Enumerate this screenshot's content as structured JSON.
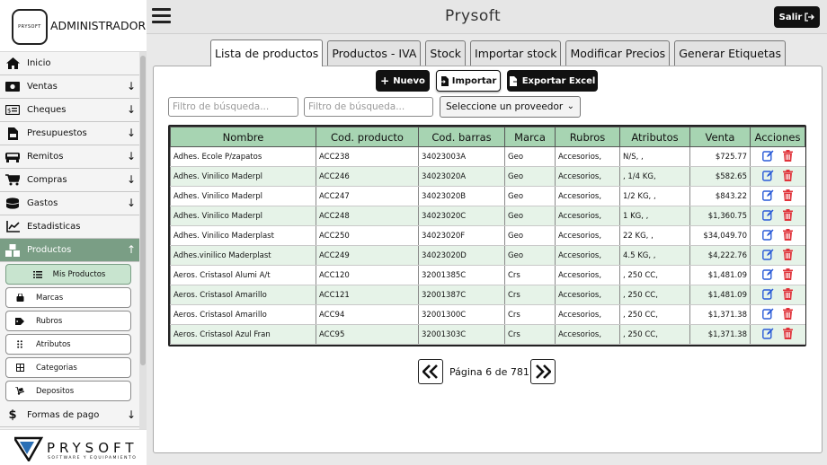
{
  "brand": {
    "title": "ADMINISTRADOR",
    "logo_text": "PRYSOFT"
  },
  "topbar": {
    "title": "Prysoft",
    "logout_label": "Salir"
  },
  "sidebar": {
    "items": [
      {
        "label": "Inicio",
        "icon": "home-icon",
        "arrow": ""
      },
      {
        "label": "Ventas",
        "icon": "money-icon",
        "arrow": "↓"
      },
      {
        "label": "Cheques",
        "icon": "cheque-icon",
        "arrow": "↓"
      },
      {
        "label": "Presupuestos",
        "icon": "file-invoice-icon",
        "arrow": "↓"
      },
      {
        "label": "Remitos",
        "icon": "truck-icon",
        "arrow": "↓"
      },
      {
        "label": "Compras",
        "icon": "cart-icon",
        "arrow": "↓"
      },
      {
        "label": "Gastos",
        "icon": "coins-icon",
        "arrow": "↓"
      },
      {
        "label": "Estadisticas",
        "icon": "chart-line-icon",
        "arrow": ""
      },
      {
        "label": "Productos",
        "icon": "boxes-icon",
        "arrow": "↑"
      }
    ],
    "subitems": [
      {
        "label": "Mis Productos",
        "icon": "list-icon"
      },
      {
        "label": "Marcas",
        "icon": "bag-icon"
      },
      {
        "label": "Rubros",
        "icon": "tags-icon"
      },
      {
        "label": "Atributos",
        "icon": "grip-icon"
      },
      {
        "label": "Categorias",
        "icon": "table-icon"
      },
      {
        "label": "Depositos",
        "icon": "dolly-icon"
      }
    ],
    "last_item": {
      "label": "Formas de pago",
      "icon": "dollar-icon",
      "arrow": "↓"
    },
    "footer": {
      "logo_text": "PRYSOFT",
      "logo_sub": "SOFTWARE Y EQUIPAMIENTO"
    }
  },
  "tabs": [
    "Lista de productos",
    "Productos - IVA",
    "Stock",
    "Importar stock",
    "Modificar Precios",
    "Generar Etiquetas"
  ],
  "actions": {
    "new_label": "Nuevo",
    "import_label": "Importar",
    "export_label": "Exportar Excel"
  },
  "filters": {
    "placeholder1": "Filtro de búsqueda...",
    "placeholder2": "Filtro de búsqueda...",
    "provider_select": "Seleccione un proveedor"
  },
  "table": {
    "headers": [
      "Nombre",
      "Cod. producto",
      "Cod. barras",
      "Marca",
      "Rubros",
      "Atributos",
      "Venta",
      "Acciones"
    ],
    "rows": [
      [
        "Adhes. Ecole P/zapatos",
        "ACC238",
        "34023003A",
        "Geo",
        "Accesorios,",
        "N/S, ,",
        "$725.77"
      ],
      [
        "Adhes. Vinilico Maderpl",
        "ACC246",
        "34023020A",
        "Geo",
        "Accesorios,",
        ", 1/4 KG,",
        "$582.65"
      ],
      [
        "Adhes. Vinilico Maderpl",
        "ACC247",
        "34023020B",
        "Geo",
        "Accesorios,",
        "1/2 KG, ,",
        "$843.22"
      ],
      [
        "Adhes. Vinilico Maderpl",
        "ACC248",
        "34023020C",
        "Geo",
        "Accesorios,",
        "1 KG, ,",
        "$1,360.75"
      ],
      [
        "Adhes. Vinilico Maderplast",
        "ACC250",
        "34023020F",
        "Geo",
        "Accesorios,",
        "22 KG, ,",
        "$34,049.70"
      ],
      [
        "Adhes.vinilico Maderplast",
        "ACC249",
        "34023020D",
        "Geo",
        "Accesorios,",
        "4.5 KG, ,",
        "$4,222.76"
      ],
      [
        "Aeros. Cristasol Alumi A/t",
        "ACC120",
        "32001385C",
        "Crs",
        "Accesorios,",
        ", 250 CC,",
        "$1,481.09"
      ],
      [
        "Aeros. Cristasol Amarillo",
        "ACC121",
        "32001387C",
        "Crs",
        "Accesorios,",
        ", 250 CC,",
        "$1,481.09"
      ],
      [
        "Aeros. Cristasol Amarillo",
        "ACC94",
        "32001300C",
        "Crs",
        "Accesorios,",
        ", 250 CC,",
        "$1,371.38"
      ],
      [
        "Aeros. Cristasol Azul Fran",
        "ACC95",
        "32001303C",
        "Crs",
        "Accesorios,",
        ", 250 CC,",
        "$1,371.38"
      ]
    ]
  },
  "pagination": {
    "text": "Página 6 de 781"
  },
  "colors": {
    "accent": "#7a9e85",
    "header_green": "#a7d4b2",
    "edit": "#2a5bd7",
    "delete": "#e0333a"
  }
}
